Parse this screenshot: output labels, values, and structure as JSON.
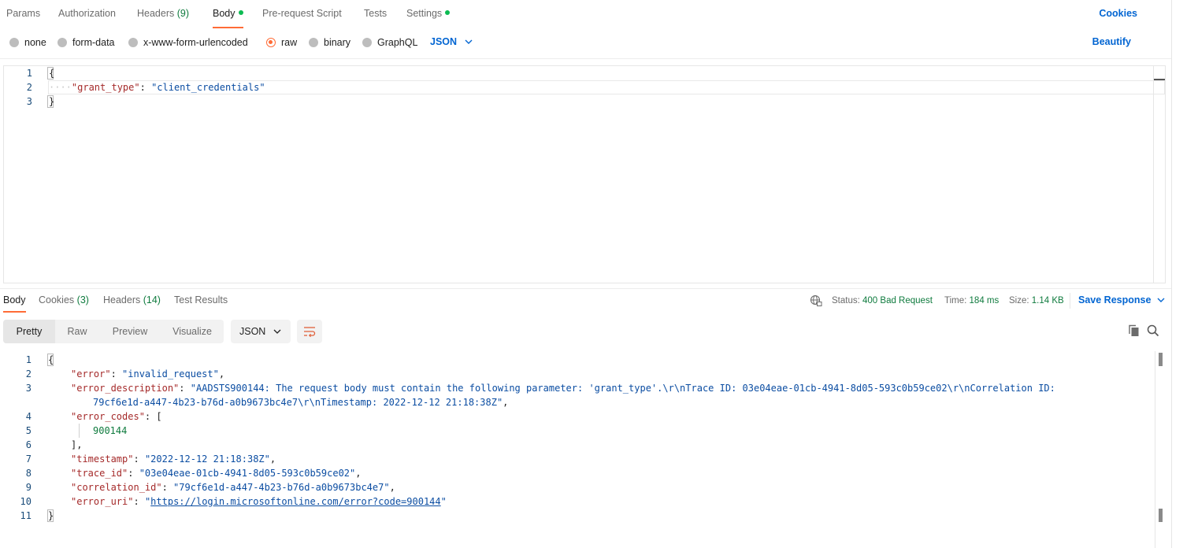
{
  "request_tabs": [
    {
      "label": "Params"
    },
    {
      "label": "Authorization"
    },
    {
      "label": "Headers",
      "count": "(9)"
    },
    {
      "label": "Body"
    },
    {
      "label": "Pre-request Script"
    },
    {
      "label": "Tests"
    },
    {
      "label": "Settings"
    }
  ],
  "cookies_label": "Cookies",
  "body_types": [
    "none",
    "form-data",
    "x-www-form-urlencoded",
    "raw",
    "binary",
    "GraphQL"
  ],
  "selected_body_type": "raw",
  "raw_language": "JSON",
  "beautify_label": "Beautify",
  "request_body": {
    "line_numbers": [
      "1",
      "2",
      "3"
    ],
    "open_brace": "{",
    "close_brace": "}",
    "indent_dots": "····",
    "key": "\"grant_type\"",
    "colon": ": ",
    "value": "\"client_credentials\""
  },
  "response_tabs": [
    {
      "label": "Body"
    },
    {
      "label": "Cookies",
      "count": "(3)"
    },
    {
      "label": "Headers",
      "count": "(14)"
    },
    {
      "label": "Test Results"
    }
  ],
  "response_status": {
    "status_label": "Status:",
    "status_value": "400 Bad Request",
    "time_label": "Time:",
    "time_value": "184 ms",
    "size_label": "Size:",
    "size_value": "1.14 KB"
  },
  "save_response_label": "Save Response",
  "view_modes": [
    "Pretty",
    "Raw",
    "Preview",
    "Visualize"
  ],
  "response_format": "JSON",
  "response_body": {
    "line_numbers": [
      "1",
      "2",
      "3",
      "",
      "4",
      "5",
      "6",
      "7",
      "8",
      "9",
      "10",
      "11"
    ],
    "l1": "{",
    "l2_key": "\"error\"",
    "l2_val": "\"invalid_request\"",
    "l3_key": "\"error_description\"",
    "l3_val_a": "\"AADSTS900144: The request body must contain the following parameter: 'grant_type'.\\r\\nTrace ID: 03e04eae-01cb-4941-8d05-593c0b59ce02\\r\\nCorrelation ID:",
    "l3_val_b": "79cf6e1d-a447-4b23-b76d-a0b9673bc4e7\\r\\nTimestamp: 2022-12-12 21:18:38Z\"",
    "l4_key": "\"error_codes\"",
    "l4_open": "[",
    "l5_val": "900144",
    "l6_close": "],",
    "l7_key": "\"timestamp\"",
    "l7_val": "\"2022-12-12 21:18:38Z\"",
    "l8_key": "\"trace_id\"",
    "l8_val": "\"03e04eae-01cb-4941-8d05-593c0b59ce02\"",
    "l9_key": "\"correlation_id\"",
    "l9_val": "\"79cf6e1d-a447-4b23-b76d-a0b9673bc4e7\"",
    "l10_key": "\"error_uri\"",
    "l10_quote_open": "\"",
    "l10_url": "https://login.microsoftonline.com/error?code=900144",
    "l10_quote_close": "\"",
    "l11": "}",
    "colon": ": ",
    "comma": ","
  },
  "colors": {
    "accent": "#ff6c37",
    "link": "#0265d2",
    "success": "#0f7b3e",
    "json_key": "#a52a2a",
    "json_string": "#0b4da2"
  }
}
